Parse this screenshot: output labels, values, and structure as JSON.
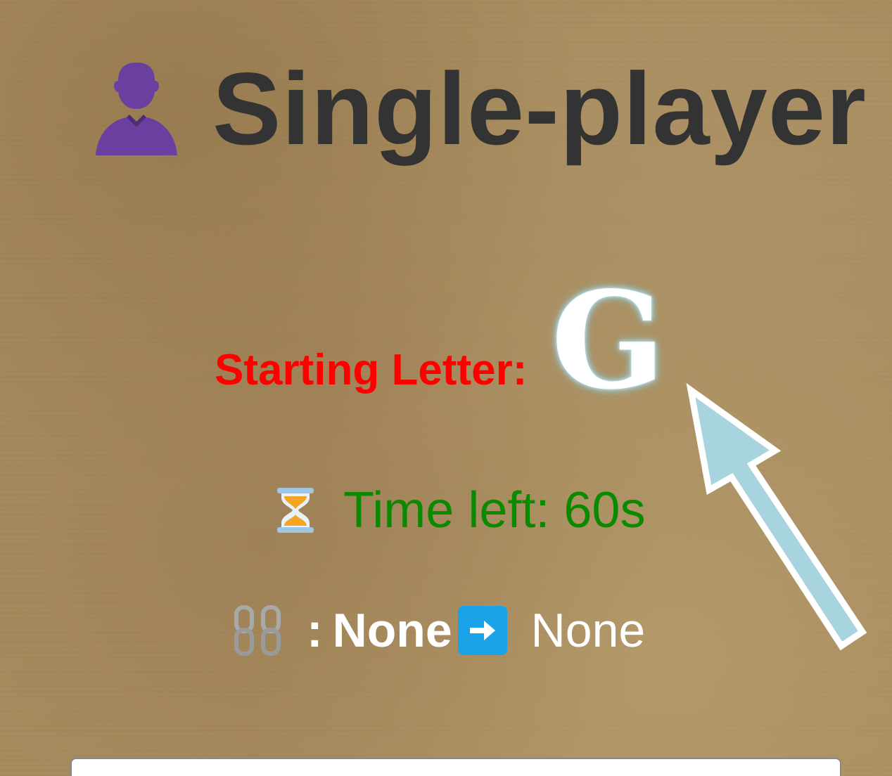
{
  "header": {
    "icon": "person-silhouette-icon",
    "icon_color": "#6b3fa0",
    "title": "Single-player"
  },
  "starting_letter": {
    "label": "Starting Letter:",
    "label_color": "#ff0000",
    "letter": "G",
    "pointer_icon": "pointer-arrow-icon",
    "pointer_color": "#a8d4e0"
  },
  "timer": {
    "icon": "hourglass-icon",
    "text": "Time left: 60s",
    "color": "#0a8a00"
  },
  "chain": {
    "icon": "chain-link-icon",
    "separator": ":",
    "from_word": "None",
    "arrow_icon": "right-arrow-icon",
    "arrow_color": "#1aa3e8",
    "to_word": "None"
  },
  "input": {
    "value": "",
    "placeholder": ""
  }
}
